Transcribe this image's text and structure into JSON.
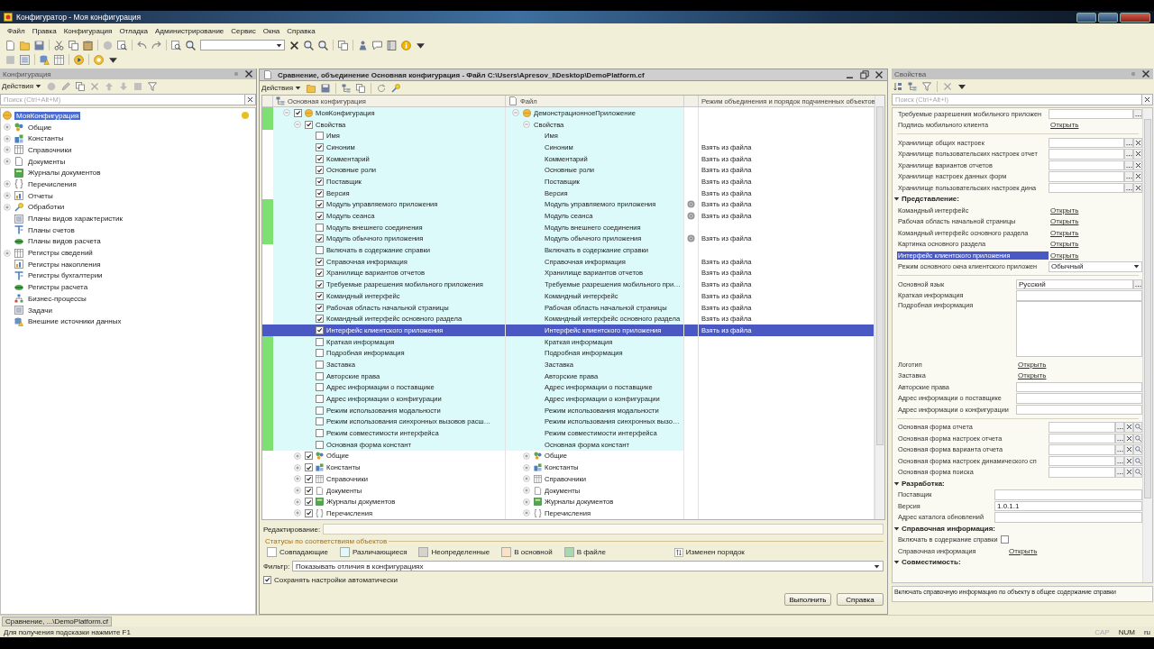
{
  "window": {
    "title": "Конфигуратор - Моя конфигурация"
  },
  "menu": [
    "Файл",
    "Правка",
    "Конфигурация",
    "Отладка",
    "Администрирование",
    "Сервис",
    "Окна",
    "Справка"
  ],
  "config_panel": {
    "title": "Конфигурация",
    "actions_label": "Действия",
    "search": {
      "placeholder": "Поиск (Ctrl+Alt+M)"
    },
    "root": {
      "label": "МояКонфигурация",
      "selected": true
    },
    "items": [
      {
        "label": "Общие",
        "has_children": true,
        "selected": false
      },
      {
        "label": "Константы",
        "has_children": true,
        "selected": false
      },
      {
        "label": "Справочники",
        "has_children": true,
        "selected": false
      },
      {
        "label": "Документы",
        "has_children": true,
        "selected": false
      },
      {
        "label": "Журналы документов",
        "has_children": false,
        "selected": false
      },
      {
        "label": "Перечисления",
        "has_children": true,
        "selected": false
      },
      {
        "label": "Отчеты",
        "has_children": true,
        "selected": false
      },
      {
        "label": "Обработки",
        "has_children": true,
        "selected": false
      },
      {
        "label": "Планы видов характеристик",
        "has_children": false,
        "selected": false
      },
      {
        "label": "Планы счетов",
        "has_children": false,
        "selected": false
      },
      {
        "label": "Планы видов расчета",
        "has_children": false,
        "selected": false
      },
      {
        "label": "Регистры сведений",
        "has_children": true,
        "selected": false
      },
      {
        "label": "Регистры накопления",
        "has_children": false,
        "selected": false
      },
      {
        "label": "Регистры бухгалтерии",
        "has_children": false,
        "selected": false
      },
      {
        "label": "Регистры расчета",
        "has_children": false,
        "selected": false
      },
      {
        "label": "Бизнес-процессы",
        "has_children": false,
        "selected": false
      },
      {
        "label": "Задачи",
        "has_children": false,
        "selected": false
      },
      {
        "label": "Внешние источники данных",
        "has_children": false,
        "selected": false
      }
    ]
  },
  "compare": {
    "title": "Сравнение, объединение Основная конфигурация - Файл C:\\Users\\Apresov_I\\Desktop\\DemoPlatform.cf",
    "actions_label": "Действия",
    "columns": [
      "Основная конфигурация",
      "Файл",
      "Режим объединения и порядок подчиненных объектов"
    ],
    "rows": [
      {
        "main": "МояКонфигурация",
        "file": "ДемонстрационноеПриложение",
        "checked": true,
        "expanded": true,
        "changed": true,
        "differs": true,
        "selected": false,
        "children": [
          {
            "main": "Свойства",
            "file": "Свойства",
            "checked": true,
            "expanded": true,
            "changed": true,
            "differs": true,
            "selected": false,
            "children": [
              {
                "main": "Имя",
                "file": "Имя",
                "checked": false,
                "changed": false,
                "differs": true,
                "selected": false
              },
              {
                "main": "Синоним",
                "file": "Синоним",
                "checked": true,
                "changed": false,
                "differs": true,
                "selected": false,
                "mode": "Взять из файла"
              },
              {
                "main": "Комментарий",
                "file": "Комментарий",
                "checked": true,
                "changed": false,
                "differs": true,
                "selected": false,
                "mode": "Взять из файла"
              },
              {
                "main": "Основные роли",
                "file": "Основные роли",
                "checked": true,
                "changed": false,
                "differs": true,
                "selected": false,
                "mode": "Взять из файла"
              },
              {
                "main": "Поставщик",
                "file": "Поставщик",
                "checked": true,
                "changed": false,
                "differs": true,
                "selected": false,
                "mode": "Взять из файла"
              },
              {
                "main": "Версия",
                "file": "Версия",
                "checked": true,
                "changed": false,
                "differs": true,
                "selected": false,
                "mode": "Взять из файла"
              },
              {
                "main": "Модуль управляемого приложения",
                "file": "Модуль управляемого приложения",
                "checked": true,
                "changed": true,
                "differs": true,
                "selected": false,
                "module": true,
                "mode": "Взять из файла"
              },
              {
                "main": "Модуль сеанса",
                "file": "Модуль сеанса",
                "checked": true,
                "changed": true,
                "differs": true,
                "selected": false,
                "module": true,
                "mode": "Взять из файла"
              },
              {
                "main": "Модуль внешнего соединения",
                "file": "Модуль внешнего соединения",
                "checked": false,
                "changed": true,
                "differs": true,
                "selected": false
              },
              {
                "main": "Модуль обычного приложения",
                "file": "Модуль обычного приложения",
                "checked": true,
                "changed": true,
                "differs": true,
                "selected": false,
                "module": true,
                "mode": "Взять из файла"
              },
              {
                "main": "Включать в содержание справки",
                "file": "Включать в содержание справки",
                "checked": false,
                "changed": false,
                "differs": true,
                "selected": false
              },
              {
                "main": "Справочная информация",
                "file": "Справочная информация",
                "checked": true,
                "changed": false,
                "differs": true,
                "selected": false,
                "mode": "Взять из файла"
              },
              {
                "main": "Хранилище вариантов отчетов",
                "file": "Хранилище вариантов отчетов",
                "checked": true,
                "changed": false,
                "differs": true,
                "selected": false,
                "mode": "Взять из файла"
              },
              {
                "main": "Требуемые разрешения мобильного приложения",
                "file": "Требуемые разрешения мобильного при…",
                "checked": true,
                "changed": false,
                "differs": true,
                "selected": false,
                "mode": "Взять из файла"
              },
              {
                "main": "Командный интерфейс",
                "file": "Командный интерфейс",
                "checked": true,
                "changed": false,
                "differs": true,
                "selected": false,
                "mode": "Взять из файла"
              },
              {
                "main": "Рабочая область начальной страницы",
                "file": "Рабочая область начальной страницы",
                "checked": true,
                "changed": false,
                "differs": true,
                "selected": false,
                "mode": "Взять из файла"
              },
              {
                "main": "Командный интерфейс основного раздела",
                "file": "Командный интерфейс основного раздела",
                "checked": true,
                "changed": false,
                "differs": true,
                "selected": false,
                "mode": "Взять из файла"
              },
              {
                "main": "Интерфейс клиентского приложения",
                "file": "Интерфейс клиентского приложения",
                "checked": true,
                "changed": false,
                "differs": true,
                "selected": true,
                "mode": "Взять из файла"
              },
              {
                "main": "Краткая информация",
                "file": "Краткая информация",
                "checked": false,
                "changed": true,
                "differs": true,
                "selected": false
              },
              {
                "main": "Подробная информация",
                "file": "Подробная информация",
                "checked": false,
                "changed": true,
                "differs": true,
                "selected": false
              },
              {
                "main": "Заставка",
                "file": "Заставка",
                "checked": false,
                "changed": true,
                "differs": true,
                "selected": false
              },
              {
                "main": "Авторские права",
                "file": "Авторские права",
                "checked": false,
                "changed": true,
                "differs": true,
                "selected": false
              },
              {
                "main": "Адрес информации о поставщике",
                "file": "Адрес информации о поставщике",
                "checked": false,
                "changed": true,
                "differs": true,
                "selected": false
              },
              {
                "main": "Адрес информации о конфигурации",
                "file": "Адрес информации о конфигурации",
                "checked": false,
                "changed": true,
                "differs": true,
                "selected": false
              },
              {
                "main": "Режим использования модальности",
                "file": "Режим использования модальности",
                "checked": false,
                "changed": true,
                "differs": true,
                "selected": false
              },
              {
                "main": "Режим использования синхронных вызовов расш…",
                "file": "Режим использования синхронных вызо…",
                "checked": false,
                "changed": true,
                "differs": true,
                "selected": false
              },
              {
                "main": "Режим совместимости интерфейса",
                "file": "Режим совместимости интерфейса",
                "checked": false,
                "changed": true,
                "differs": true,
                "selected": false
              },
              {
                "main": "Основная форма констант",
                "file": "Основная форма констант",
                "checked": false,
                "changed": true,
                "differs": true,
                "selected": false
              }
            ]
          },
          {
            "main": "Общие",
            "file": "Общие",
            "checked": true,
            "expanded": false,
            "changed": false,
            "differs": false,
            "selected": false
          },
          {
            "main": "Константы",
            "file": "Константы",
            "checked": true,
            "expanded": false,
            "changed": false,
            "differs": false,
            "selected": false
          },
          {
            "main": "Справочники",
            "file": "Справочники",
            "checked": true,
            "expanded": false,
            "changed": false,
            "differs": false,
            "selected": false
          },
          {
            "main": "Документы",
            "file": "Документы",
            "checked": true,
            "expanded": false,
            "changed": false,
            "differs": false,
            "selected": false
          },
          {
            "main": "Журналы документов",
            "file": "Журналы документов",
            "checked": true,
            "expanded": false,
            "changed": false,
            "differs": false,
            "selected": false
          },
          {
            "main": "Перечисления",
            "file": "Перечисления",
            "checked": true,
            "expanded": false,
            "changed": false,
            "differs": false,
            "selected": false
          }
        ]
      }
    ],
    "editing_label": "Редактирование:",
    "legend": {
      "title": "Статусы по соответствиям объектов",
      "items": [
        {
          "label": "Совпадающие",
          "color": "#ffffff"
        },
        {
          "label": "Различающиеся",
          "color": "#e2f8fc"
        },
        {
          "label": "Неопределенные",
          "color": "#d6d2cc"
        },
        {
          "label": "В основной",
          "color": "#fce2c4"
        },
        {
          "label": "В файле",
          "color": "#a9d8b0"
        }
      ],
      "order_label": "Изменен порядок"
    },
    "filter": {
      "label": "Фильтр:",
      "value": "Показывать отличия в конфигурациях"
    },
    "autosave": {
      "label": "Сохранять настройки автоматически",
      "checked": true
    },
    "buttons": [
      "Выполнить",
      "Справка"
    ]
  },
  "properties": {
    "title": "Свойства",
    "search": {
      "placeholder": "Поиск (Ctrl+Alt+I)"
    },
    "groups": [
      {
        "kind": "wide",
        "rows": [
          {
            "kind": "choice_field",
            "label": "Требуемые разрешения мобильного приложен",
            "selected": false
          },
          {
            "kind": "link",
            "label": "Подпись мобильного клиента",
            "link": "Открыть",
            "selected": false
          }
        ]
      },
      {
        "kind": "wide",
        "rows": [
          {
            "kind": "ref_field",
            "label": "Хранилище общих настроек",
            "selected": false
          },
          {
            "kind": "ref_field",
            "label": "Хранилище пользовательских настроек отчет",
            "selected": false
          },
          {
            "kind": "ref_field",
            "label": "Хранилище вариантов отчетов",
            "selected": false
          },
          {
            "kind": "ref_field",
            "label": "Хранилище настроек данных форм",
            "selected": false
          },
          {
            "kind": "ref_field",
            "label": "Хранилище пользовательских настроек дина",
            "selected": false
          }
        ]
      },
      {
        "kind": "wide",
        "heading": "Представление:",
        "rows": [
          {
            "kind": "link",
            "label": "Командный интерфейс",
            "link": "Открыть",
            "selected": false
          },
          {
            "kind": "link",
            "label": "Рабочая область начальной страницы",
            "link": "Открыть",
            "selected": false
          },
          {
            "kind": "link",
            "label": "Командный интерфейс основного раздела",
            "link": "Открыть",
            "selected": false
          },
          {
            "kind": "link",
            "label": "Картинка основного раздела",
            "link": "Открыть",
            "selected": false
          },
          {
            "kind": "link",
            "label": "Интерфейс клиентского приложения",
            "link": "Открыть",
            "selected": true
          },
          {
            "kind": "select",
            "label": "Режим основного окна клиентского приложен",
            "value": "Обычный",
            "selected": false
          }
        ]
      },
      {
        "kind": "medium",
        "rows": [
          {
            "kind": "choice_field",
            "label": "Основной язык",
            "value": "Русский",
            "selected": false
          },
          {
            "kind": "field",
            "label": "Краткая информация",
            "selected": false
          },
          {
            "kind": "memo",
            "label": "Подробная информация",
            "selected": false
          },
          {
            "kind": "link",
            "label": "Логотип",
            "link": "Открыть",
            "selected": false
          },
          {
            "kind": "link",
            "label": "Заставка",
            "link": "Открыть",
            "selected": false
          },
          {
            "kind": "field",
            "label": "Авторские права",
            "selected": false
          },
          {
            "kind": "field",
            "label": "Адрес информации о поставщике",
            "selected": false
          },
          {
            "kind": "field",
            "label": "Адрес информации о конфигурации",
            "selected": false
          }
        ]
      },
      {
        "kind": "wide",
        "rows": [
          {
            "kind": "form_field",
            "label": "Основная форма отчета",
            "selected": false
          },
          {
            "kind": "form_field",
            "label": "Основная форма настроек отчета",
            "selected": false
          },
          {
            "kind": "form_field",
            "label": "Основная форма варианта отчета",
            "selected": false
          },
          {
            "kind": "form_field",
            "label": "Основная форма настроек динамического сп",
            "selected": false
          },
          {
            "kind": "form_field",
            "label": "Основная форма поиска",
            "selected": false
          }
        ]
      },
      {
        "kind": "narrow",
        "heading": "Разработка:",
        "rows": [
          {
            "kind": "field",
            "label": "Поставщик",
            "selected": false
          },
          {
            "kind": "field",
            "label": "Версия",
            "value": "1.0.1.1",
            "selected": false
          },
          {
            "kind": "field",
            "label": "Адрес каталога обновлений",
            "selected": false
          }
        ]
      },
      {
        "kind": "compact",
        "heading": "Справочная информация:",
        "rows": [
          {
            "kind": "checkbox",
            "label": "Включать в содержание справки",
            "checked": false,
            "selected": false
          },
          {
            "kind": "link",
            "label": "Справочная информация",
            "link": "Открыть",
            "selected": false
          }
        ]
      },
      {
        "heading": "Совместимость:"
      }
    ],
    "description": "Включать справочную информацию по объекту в общее содержание справки"
  },
  "taskbar": {
    "tab": "Сравнение, ...\\DemoPlatform.cf"
  },
  "status_bar": {
    "hint": "Для получения подсказки нажмите F1",
    "indicators": [
      {
        "label": "CAP",
        "on": false
      },
      {
        "label": "NUM",
        "on": true
      },
      {
        "label": "ru",
        "on": true
      }
    ]
  }
}
